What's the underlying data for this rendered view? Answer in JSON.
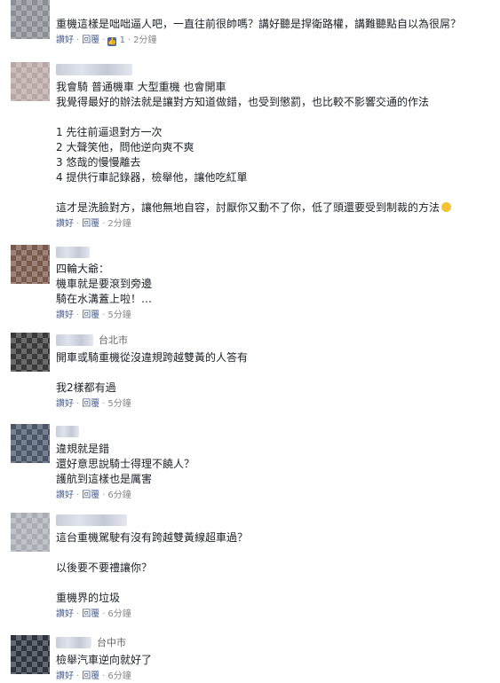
{
  "actions": {
    "like": "讚好",
    "reply": "回覆",
    "sep": "·"
  },
  "comments": [
    {
      "location": "",
      "lines": [
        "重機這樣是咄咄逼人吧，一直往前很帥嗎？講好聽是捍衛路權，講難聽點自以為很屌？"
      ],
      "likes": "1",
      "time": "2分鐘"
    },
    {
      "location": "",
      "lines": [
        "我會騎 普通機車 大型重機 也會開車",
        "我覺得最好的辦法就是讓對方知道做錯，也受到懲罰，也比較不影響交通的作法",
        "",
        "1 先往前逼退對方一次",
        "2 大聲笑他，問他逆向爽不爽",
        "3 悠哉的慢慢離去",
        "4 提供行車記錄器，檢舉他，讓他吃紅單",
        "",
        "這才是洗臉對方，讓他無地自容，討厭你又動不了你，低了頭還要受到制裁的方法"
      ],
      "time": "2分鐘"
    },
    {
      "location": "",
      "lines": [
        "四輪大爺：",
        "機車就是要滾到旁邊",
        "騎在水溝蓋上啦！…"
      ],
      "time": "5分鐘"
    },
    {
      "location": "台北市",
      "lines": [
        "開車或騎重機從沒違規跨越雙黃的人答有",
        "",
        "我2樣都有過"
      ],
      "time": "5分鐘"
    },
    {
      "location": "",
      "lines": [
        "違規就是錯",
        "還好意思說騎士得理不饒人？",
        "護航到這樣也是厲害"
      ],
      "time": "6分鐘"
    },
    {
      "location": "",
      "lines": [
        "這台重機駕駛有沒有跨越雙黃線超車過？",
        "",
        "以後要不要禮讓你？",
        "",
        "重機界的垃圾"
      ],
      "time": "6分鐘"
    },
    {
      "location": "台中市",
      "lines": [
        "檢舉汽車逆向就好了"
      ],
      "time": "6分鐘"
    }
  ]
}
